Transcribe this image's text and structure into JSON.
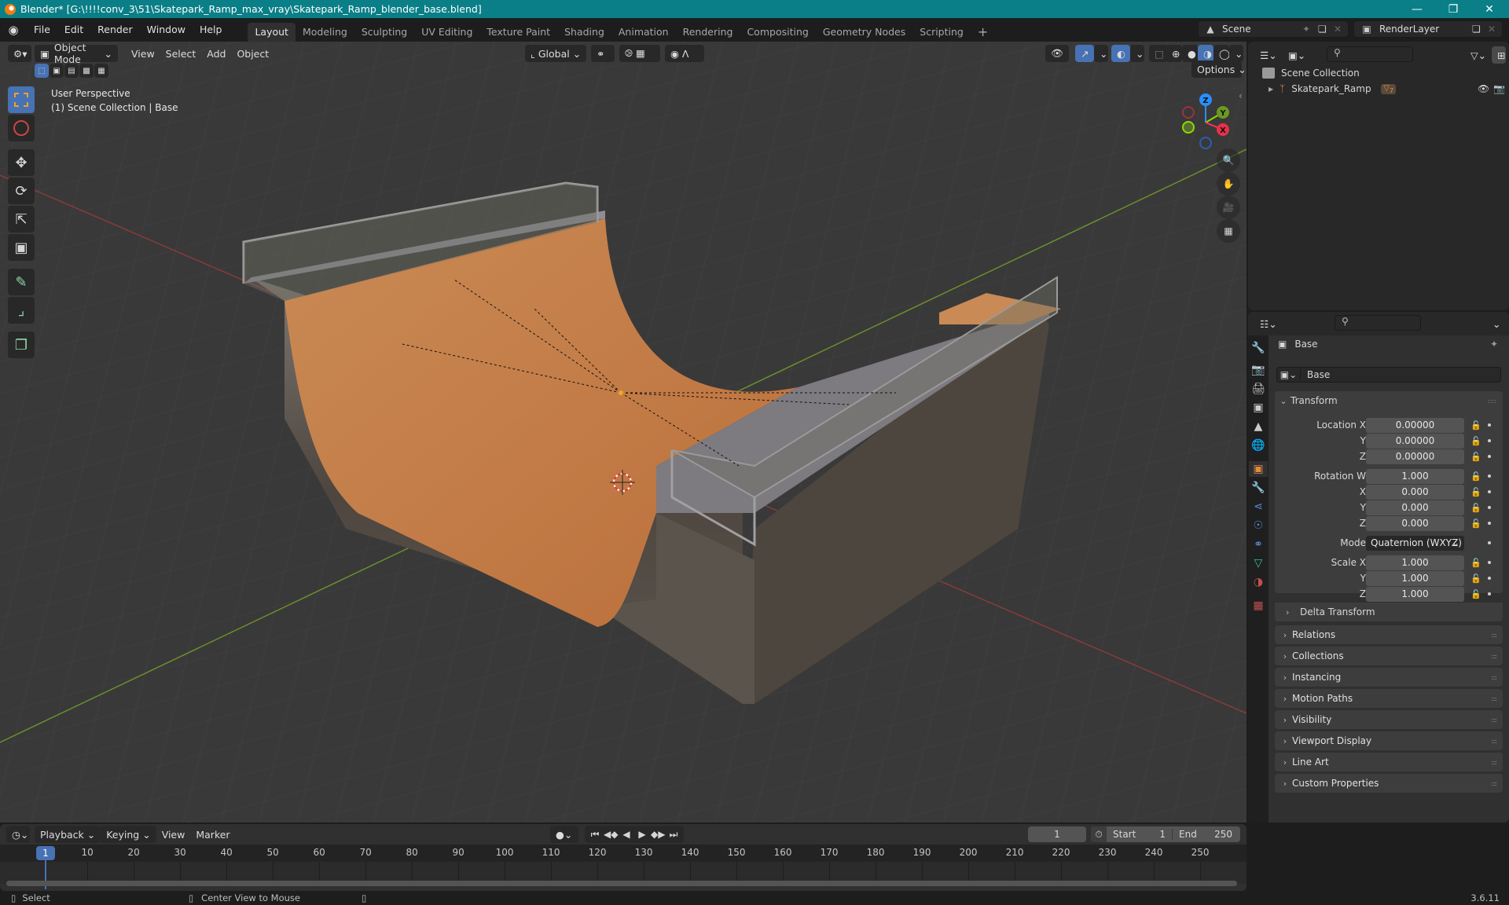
{
  "window": {
    "title": "Blender* [G:\\!!!!conv_3\\51\\Skatepark_Ramp_max_vray\\Skatepark_Ramp_blender_base.blend]",
    "controls": [
      "minimize",
      "maximize",
      "close"
    ]
  },
  "menubar": {
    "menus": [
      "File",
      "Edit",
      "Render",
      "Window",
      "Help"
    ],
    "workspaces": [
      "Layout",
      "Modeling",
      "Sculpting",
      "UV Editing",
      "Texture Paint",
      "Shading",
      "Animation",
      "Rendering",
      "Compositing",
      "Geometry Nodes",
      "Scripting"
    ],
    "active_workspace": "Layout",
    "add_workspace": "+",
    "scene": "Scene",
    "view_layer": "RenderLayer"
  },
  "viewport": {
    "mode": "Object Mode",
    "menus": [
      "View",
      "Select",
      "Add",
      "Object"
    ],
    "orientation": "Global",
    "options_label": "Options",
    "overlay_line1": "User Perspective",
    "overlay_line2": "(1) Scene Collection | Base",
    "gizmo_axes": {
      "x": "X",
      "y": "Y",
      "z": "Z"
    },
    "axis_colors": {
      "x": "#ff3352",
      "y": "#8bdc00",
      "z": "#2890ff"
    },
    "tools": [
      "select-box",
      "cursor",
      "move",
      "rotate",
      "scale",
      "transform",
      "annotate",
      "measure",
      "add-cube"
    ],
    "nav_buttons": [
      "zoom",
      "pan",
      "camera",
      "perspective-toggle"
    ],
    "object_color": "#c6804a"
  },
  "outliner": {
    "root": "Scene Collection",
    "items": [
      {
        "name": "Skatepark_Ramp",
        "children_badge": "7"
      }
    ]
  },
  "properties": {
    "object_name": "Base",
    "datablock_name": "Base",
    "transform_label": "Transform",
    "location": {
      "label": "Location X",
      "x": "0.00000",
      "y": "0.00000",
      "z": "0.00000"
    },
    "rotation": {
      "label": "Rotation W",
      "w": "1.000",
      "x": "0.000",
      "y": "0.000",
      "z": "0.000"
    },
    "mode": {
      "label": "Mode",
      "value": "Quaternion (WXYZ)"
    },
    "scale": {
      "label": "Scale X",
      "x": "1.000",
      "y": "1.000",
      "z": "1.000"
    },
    "axis_labels": {
      "y": "Y",
      "z": "Z",
      "x": "X"
    },
    "delta_transform": "Delta Transform",
    "panels": [
      "Relations",
      "Collections",
      "Instancing",
      "Motion Paths",
      "Visibility",
      "Viewport Display",
      "Line Art",
      "Custom Properties"
    ]
  },
  "timeline": {
    "menus": [
      "Playback",
      "Keying",
      "View",
      "Marker"
    ],
    "current_frame": "1",
    "start_label": "Start",
    "start": "1",
    "end_label": "End",
    "end": "250",
    "ticks": [
      "10",
      "20",
      "30",
      "40",
      "50",
      "60",
      "70",
      "80",
      "90",
      "100",
      "110",
      "120",
      "130",
      "140",
      "150",
      "160",
      "170",
      "180",
      "190",
      "200",
      "210",
      "220",
      "230",
      "240",
      "250"
    ],
    "playhead": "1"
  },
  "statusbar": {
    "left": "Select",
    "middle": "Center View to Mouse",
    "version": "3.6.11"
  }
}
